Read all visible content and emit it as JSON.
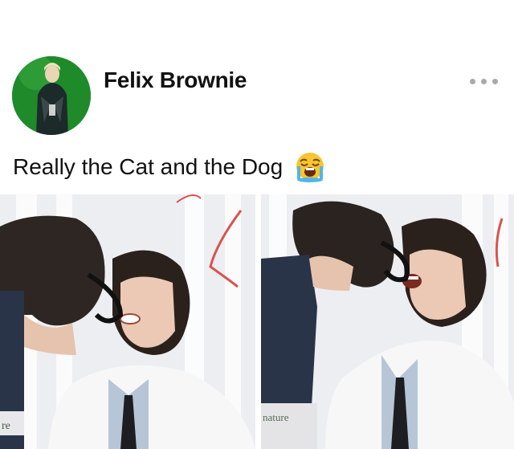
{
  "post": {
    "author": "Felix Brownie",
    "caption": "Really the Cat and the Dog",
    "caption_emoji": "loudly-crying-face-icon"
  },
  "photos": [
    {
      "visible_sign_text": "re"
    },
    {
      "visible_sign_text": "nature"
    }
  ],
  "colors": {
    "avatar_bg": "#1f8a2a",
    "text": "#111111",
    "more_dots": "#aaaaaa"
  }
}
